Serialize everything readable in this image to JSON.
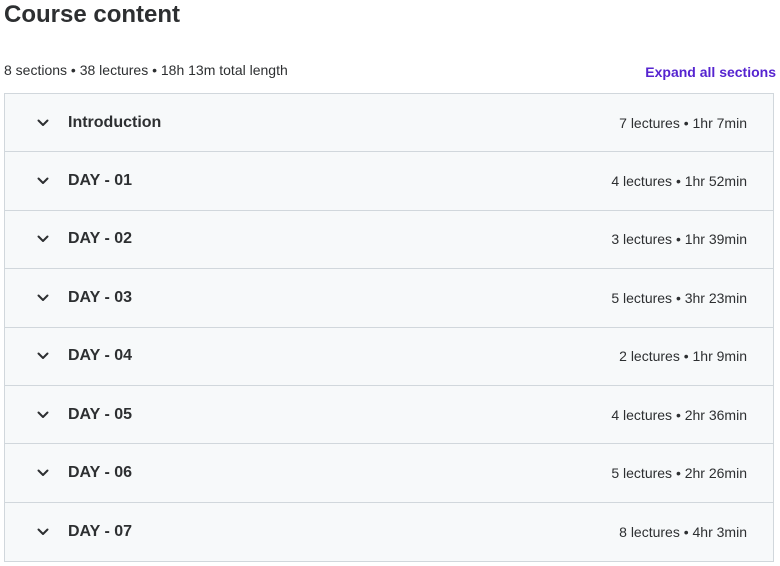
{
  "header": {
    "title": "Course content"
  },
  "summary": {
    "text": "8 sections • 38 lectures • 18h 13m total length",
    "expand_label": "Expand all sections"
  },
  "sections": [
    {
      "title": "Introduction",
      "meta": "7 lectures • 1hr 7min",
      "icon": "chevron-down-icon"
    },
    {
      "title": "DAY - 01",
      "meta": "4 lectures • 1hr 52min",
      "icon": "chevron-down-icon"
    },
    {
      "title": "DAY - 02",
      "meta": "3 lectures • 1hr 39min",
      "icon": "chevron-down-icon"
    },
    {
      "title": "DAY - 03",
      "meta": "5 lectures • 3hr 23min",
      "icon": "chevron-down-icon"
    },
    {
      "title": "DAY - 04",
      "meta": "2 lectures • 1hr 9min",
      "icon": "chevron-down-icon"
    },
    {
      "title": "DAY - 05",
      "meta": "4 lectures • 2hr 36min",
      "icon": "chevron-down-icon"
    },
    {
      "title": "DAY - 06",
      "meta": "5 lectures • 2hr 26min",
      "icon": "chevron-down-icon"
    },
    {
      "title": "DAY - 07",
      "meta": "8 lectures • 4hr 3min",
      "icon": "chevron-down-icon"
    }
  ],
  "colors": {
    "accent": "#5624d0",
    "row_background": "#f7f9fa",
    "border": "#d1d7dc",
    "text": "#2d2f31"
  }
}
